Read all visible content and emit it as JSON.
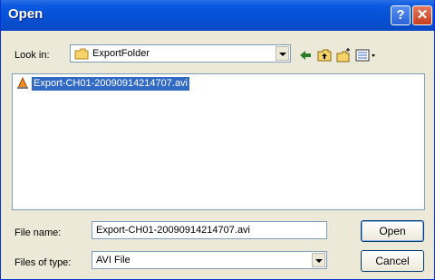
{
  "window": {
    "title": "Open"
  },
  "look_in": {
    "label": "Look in:",
    "value": "ExportFolder"
  },
  "files": [
    {
      "name": "Export-CH01-20090914214707.avi"
    }
  ],
  "file_name": {
    "label": "File name:",
    "value": "Export-CH01-20090914214707.avi"
  },
  "files_of_type": {
    "label": "Files of type:",
    "value": "AVI File"
  },
  "buttons": {
    "open": "Open",
    "cancel": "Cancel"
  },
  "titlebar_buttons": {
    "help": "?",
    "close": "✕"
  },
  "icons": [
    "folder-icon",
    "back-arrow-icon",
    "up-folder-icon",
    "new-folder-icon",
    "view-menu-icon",
    "vlc-file-icon"
  ]
}
